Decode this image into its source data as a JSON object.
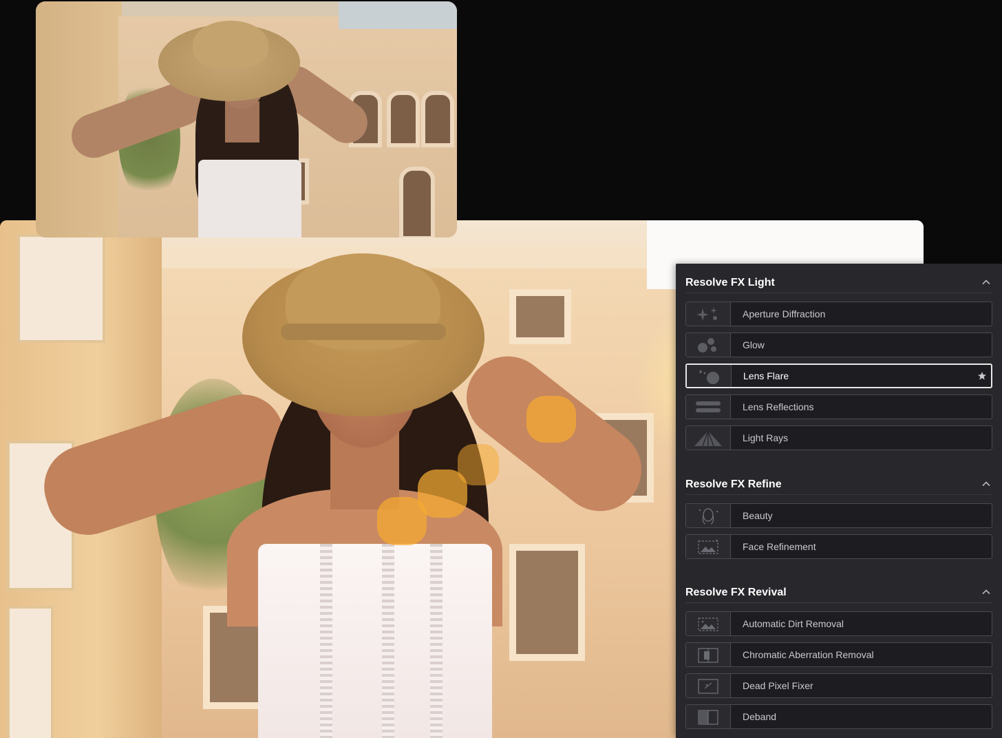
{
  "images": {
    "before": {
      "name": "original-photo"
    },
    "after": {
      "name": "lens-flare-result-photo"
    }
  },
  "fx_panel": {
    "sections": [
      {
        "title": "Resolve FX Light",
        "items": [
          {
            "label": "Aperture Diffraction",
            "icon": "aperture-diffraction-icon",
            "selected": false
          },
          {
            "label": "Glow",
            "icon": "glow-icon",
            "selected": false
          },
          {
            "label": "Lens Flare",
            "icon": "lens-flare-icon",
            "selected": true,
            "favorite": true
          },
          {
            "label": "Lens Reflections",
            "icon": "lens-reflections-icon",
            "selected": false
          },
          {
            "label": "Light Rays",
            "icon": "light-rays-icon",
            "selected": false
          }
        ]
      },
      {
        "title": "Resolve FX Refine",
        "items": [
          {
            "label": "Beauty",
            "icon": "beauty-icon",
            "selected": false
          },
          {
            "label": "Face Refinement",
            "icon": "face-refinement-icon",
            "selected": false
          }
        ]
      },
      {
        "title": "Resolve FX Revival",
        "items": [
          {
            "label": "Automatic Dirt Removal",
            "icon": "dirt-removal-icon",
            "selected": false
          },
          {
            "label": "Chromatic Aberration Removal",
            "icon": "chromatic-aberration-icon",
            "selected": false
          },
          {
            "label": "Dead Pixel Fixer",
            "icon": "dead-pixel-icon",
            "selected": false
          },
          {
            "label": "Deband",
            "icon": "deband-icon",
            "selected": false
          }
        ]
      }
    ]
  },
  "colors": {
    "panel_bg": "#28282c",
    "item_bg": "#1d1d21",
    "item_border": "#4a4a50",
    "selected_border": "#e8e8e8",
    "text": "#c9c9ce",
    "title": "#ffffff",
    "page_bg": "#0a0a0a"
  }
}
